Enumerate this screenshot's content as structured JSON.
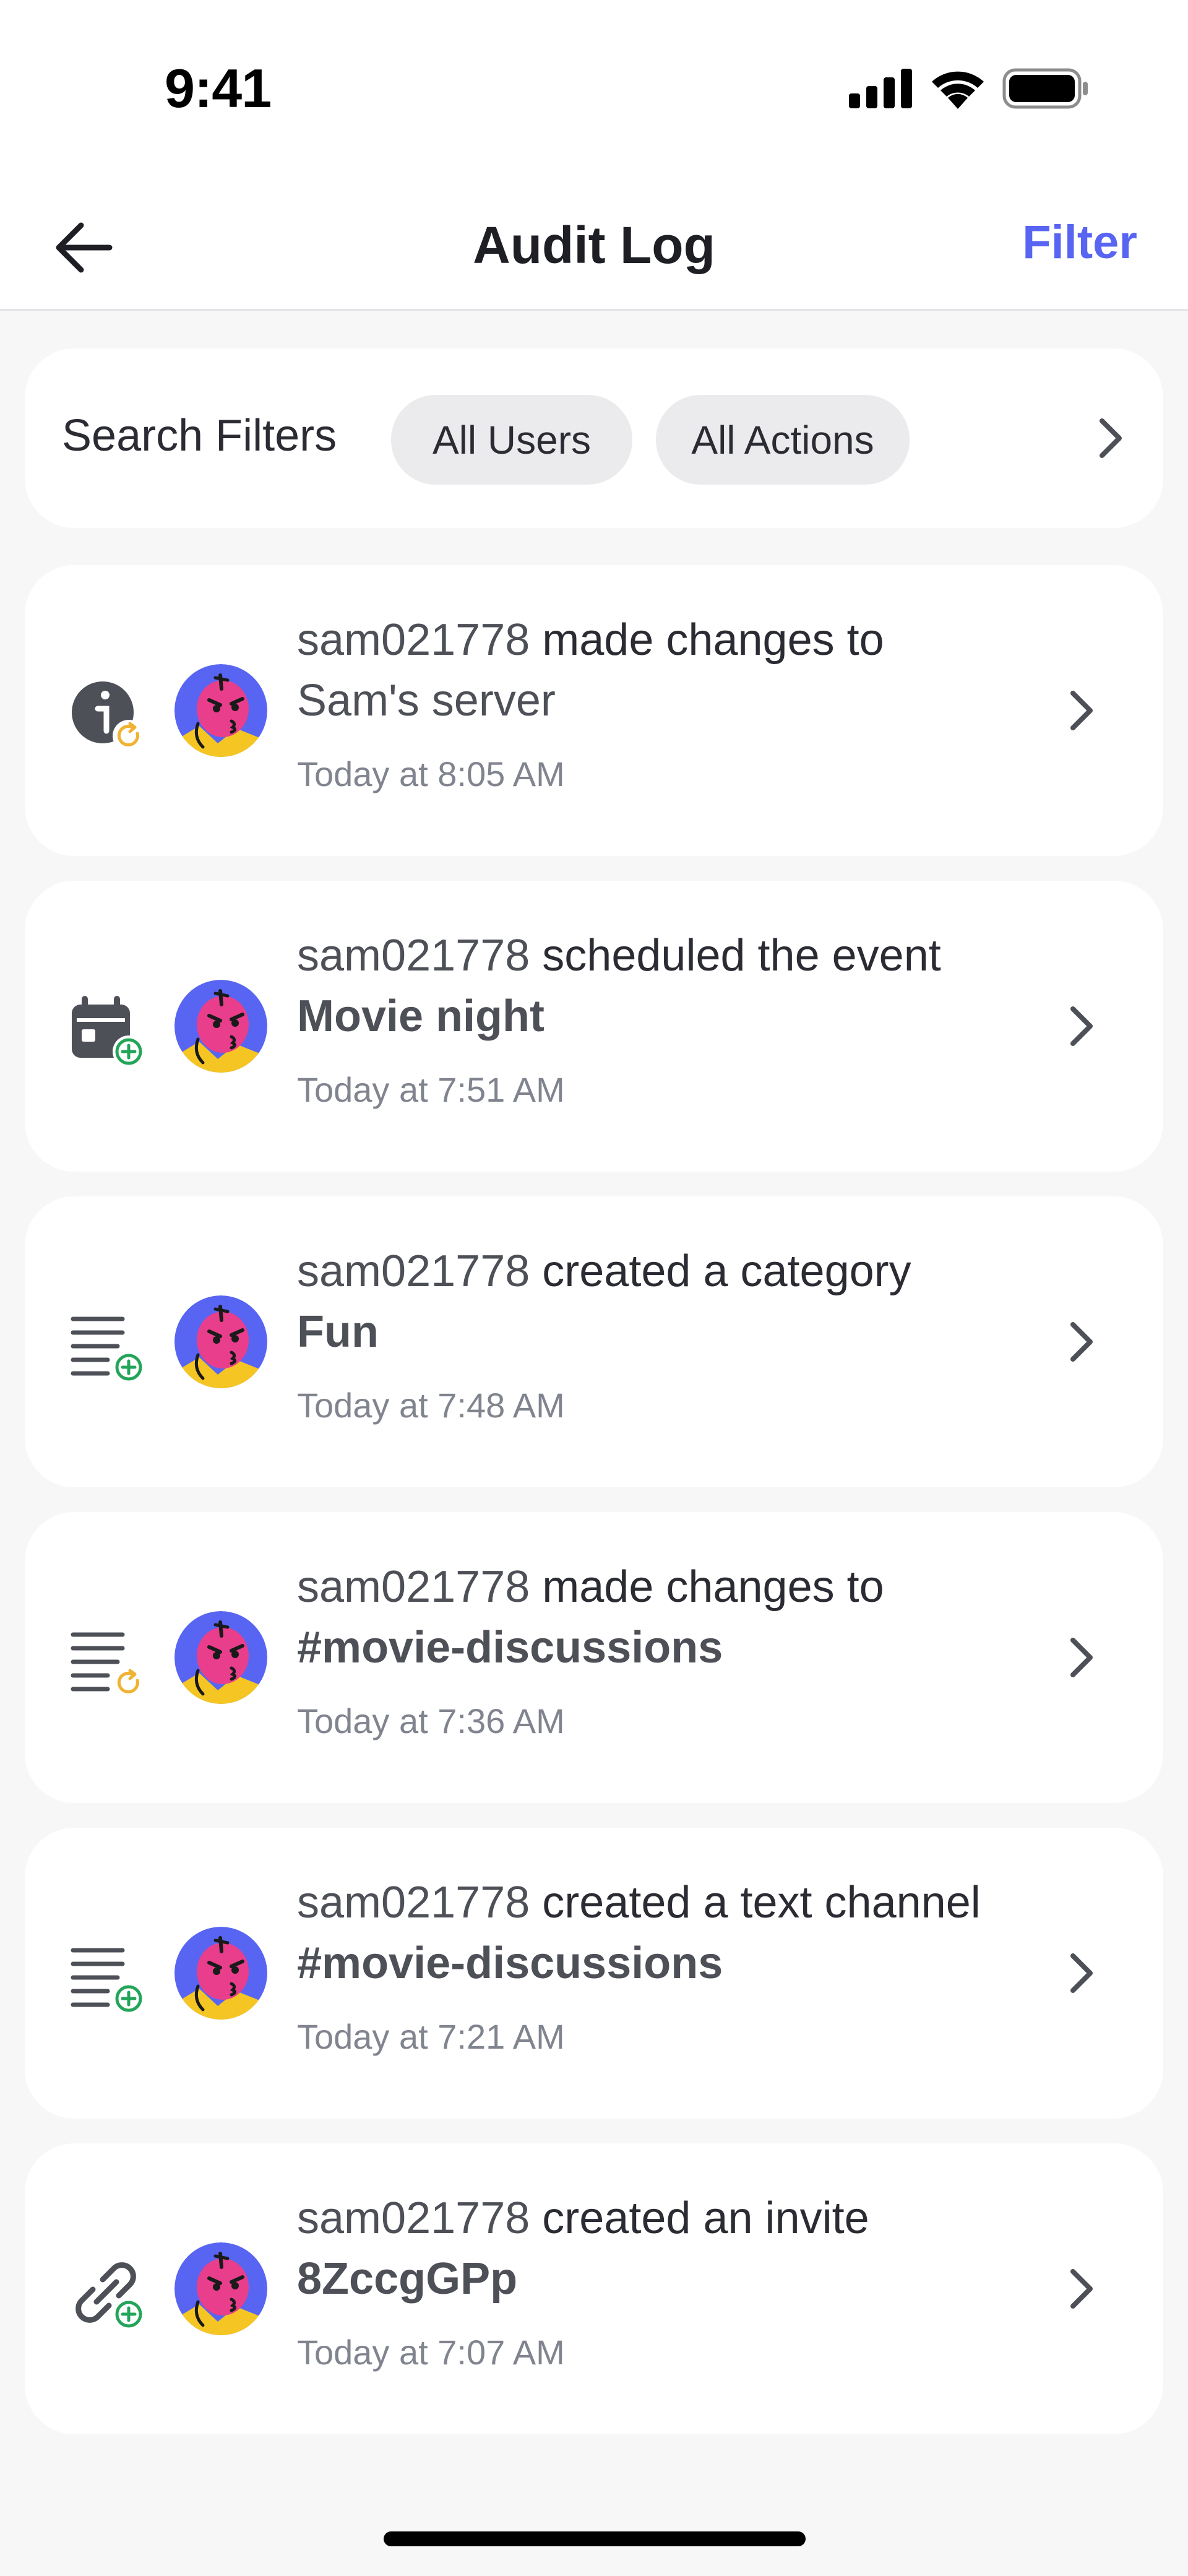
{
  "status_bar": {
    "time": "9:41",
    "icons": [
      "cellular-signal-icon",
      "wifi-icon",
      "battery-icon"
    ]
  },
  "nav": {
    "title": "Audit Log",
    "filter_label": "Filter",
    "back_icon": "arrow-left-icon"
  },
  "filters": {
    "label": "Search Filters",
    "chips": [
      "All Users",
      "All Actions"
    ]
  },
  "colors": {
    "accent": "#5865f2",
    "create_badge": "#23a559",
    "update_badge": "#f0b232",
    "avatar_bg": "#5865f2"
  },
  "entries": [
    {
      "icon": "server-update-icon",
      "user": "sam021778",
      "action": " made changes to",
      "target": "Sam's server",
      "target_bold": false,
      "time": "Today at 8:05 AM"
    },
    {
      "icon": "event-create-icon",
      "user": "sam021778",
      "action": " scheduled the event",
      "target": "Movie night",
      "target_bold": true,
      "time": "Today at 7:51 AM"
    },
    {
      "icon": "category-create-icon",
      "user": "sam021778",
      "action": " created a category",
      "target": "Fun",
      "target_bold": true,
      "time": "Today at 7:48 AM"
    },
    {
      "icon": "channel-update-icon",
      "user": "sam021778",
      "action": " made changes to",
      "target": "#movie-discussions",
      "target_bold": true,
      "time": "Today at 7:36 AM"
    },
    {
      "icon": "channel-create-icon",
      "user": "sam021778",
      "action": " created a text channel",
      "target": "#movie-discussions",
      "target_bold": true,
      "time": "Today at 7:21 AM"
    },
    {
      "icon": "invite-create-icon",
      "user": "sam021778",
      "action": " created an invite",
      "target": "8ZccgGPp",
      "target_bold": true,
      "time": "Today at 7:07 AM"
    }
  ]
}
